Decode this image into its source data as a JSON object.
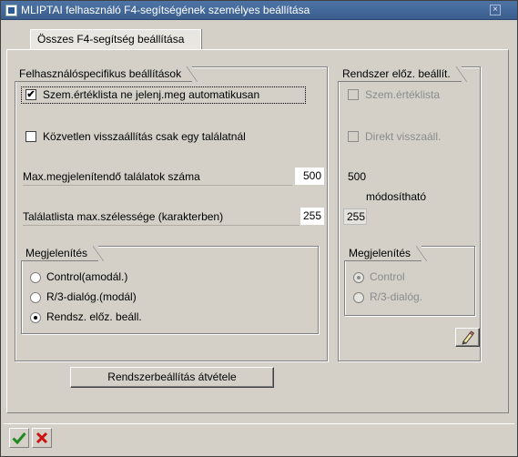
{
  "window": {
    "title": "MLIPTAI felhasználó F4-segítségének személyes beállítása"
  },
  "tab": {
    "label": "Összes F4-segítség beállítása"
  },
  "user_settings": {
    "title": "Felhasználóspecifikus beállítások",
    "checkbox1": {
      "label": "Szem.értéklista ne jelenj.meg automatikusan",
      "checked": true
    },
    "checkbox2": {
      "label": "Közvetlen visszaállítás csak egy találatnál",
      "checked": false
    },
    "max_hits": {
      "label": "Max.megjelenítendő találatok száma",
      "value": "500"
    },
    "max_width": {
      "label": "Találatlista max.szélessége (karakterben)",
      "value": "255"
    },
    "display": {
      "title": "Megjelenítés",
      "options": [
        {
          "label": "Control(amodál.)",
          "selected": false
        },
        {
          "label": "R/3-dialóg.(modál)",
          "selected": false
        },
        {
          "label": "Rendsz. előz. beáll.",
          "selected": true
        }
      ]
    }
  },
  "system_settings": {
    "title": "Rendszer előz. beállít.",
    "checkbox1": {
      "label": "Szem.értéklista"
    },
    "checkbox2": {
      "label": "Direkt visszaáll."
    },
    "max_hits_value": "500",
    "modifiable_label": "módosítható",
    "max_width_value": "255",
    "display": {
      "title": "Megjelenítés",
      "options": [
        {
          "label": "Control",
          "selected": true
        },
        {
          "label": "R/3-dialóg.",
          "selected": false
        }
      ]
    }
  },
  "buttons": {
    "adopt_system": "Rendszerbeállítás átvétele"
  },
  "icons": {
    "edit": "pencil-edit-icon",
    "confirm": "green-check-icon",
    "cancel": "red-x-icon"
  },
  "colors": {
    "title_bar": "#3f6597",
    "confirm": "#1f8a1f",
    "cancel": "#cc1111"
  }
}
